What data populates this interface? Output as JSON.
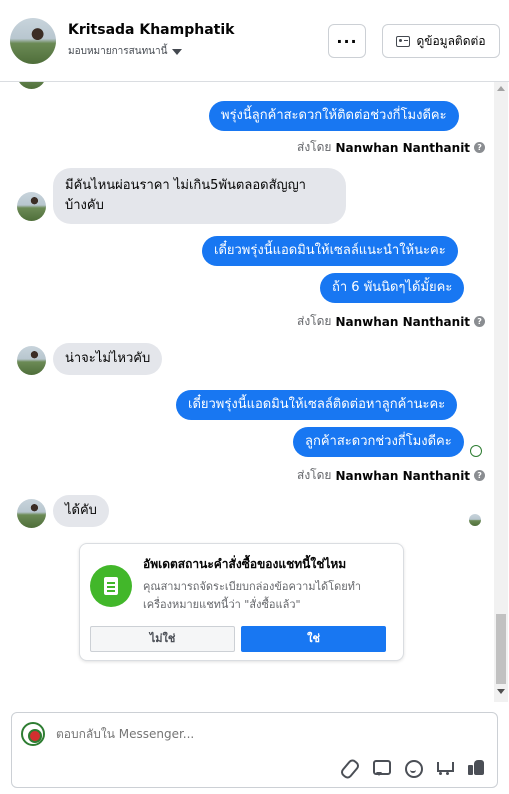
{
  "header": {
    "name": "Kritsada Khamphatik",
    "assign_label": "มอบหมายการสนทนานี้",
    "more_label": "···",
    "info_label": "ดูข้อมูลติดต่อ"
  },
  "messages": {
    "m1": "พรุ่งนี้ลูกค้าสะดวกให้ติดต่อช่วงกี่โมงดีคะ",
    "m2_line1": "มีคันไหนผ่อนราคา ไม่เกิน5พันตลอดสัญญา",
    "m2_line2": "บ้างคับ",
    "m3": "เดี๋ยวพรุ่งนี้แอดมินให้เซลล์แนะนำให้นะคะ",
    "m4": "ถ้า 6 พันนิดๆได้มั้ยคะ",
    "m5": "น่าจะไม่ไหวคับ",
    "m6": "เดี๋ยวพรุ่งนี้แอดมินให้เซลล์ติดต่อหาลูกค้านะคะ",
    "m7": "ลูกค้าสะดวกช่วงกี่โมงดีคะ",
    "m8": "ได้คับ"
  },
  "sent_by": {
    "prefix": "ส่งโดย",
    "agent": "Nanwhan Nanthanit",
    "help": "?"
  },
  "order_card": {
    "title": "อัพเดตสถานะคำสั่งซื้อของแชทนี้ใช่ไหม",
    "description": "คุณสามารถจัดระเบียบกล่องข้อความได้โดยทำเครื่องหมายแชทนี้ว่า \"สั่งซื้อแล้ว\"",
    "no_label": "ไม่ใช่",
    "yes_label": "ใช่"
  },
  "composer": {
    "placeholder": "ตอบกลับใน Messenger..."
  },
  "colors": {
    "outgoing_bubble": "#1877f2",
    "incoming_bubble": "#e4e6eb",
    "card_icon": "#42b72a"
  }
}
